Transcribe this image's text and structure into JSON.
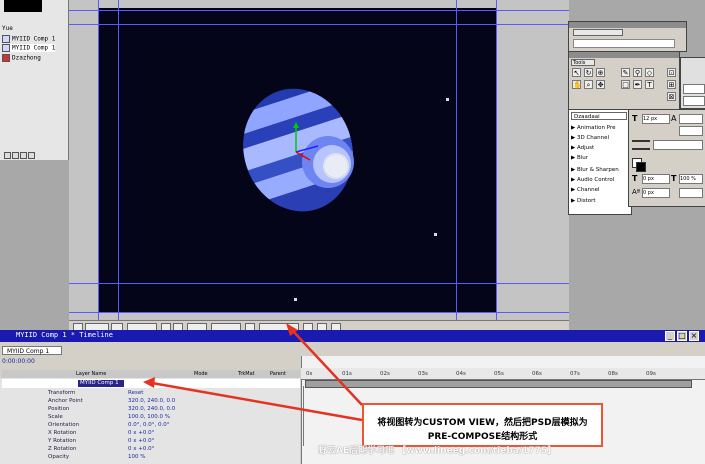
{
  "project": {
    "items": [
      {
        "label": "Yue"
      },
      {
        "label": "MYIID Comp 1"
      },
      {
        "label": "MYIID Comp 1"
      },
      {
        "label": "Dzazhong"
      }
    ]
  },
  "tools": {
    "title": "Tools"
  },
  "effects": {
    "search_value": "Dzaadaai",
    "items": [
      "▶ Animation Pre",
      "▶ 3D Channel",
      "▶ Adjust",
      "▶ Blur",
      "▶ Blur & Sharpen",
      "▶ Audio Control",
      "▶ Channel",
      "▶ Distort"
    ]
  },
  "character": {
    "font_size": "12 px",
    "size_b": "0 px",
    "v_scale": "100 %",
    "h_scale": "0 px"
  },
  "timeline": {
    "title": "MYIID Comp 1 * Timeline",
    "tab": "MYIID Comp 1",
    "time": "0:00:00:00",
    "col_source": "Layer Name",
    "col_mode": "Mode",
    "col_trk": "TrkMat",
    "col_parent": "Parent",
    "layer_name": "MYIID Comp 1",
    "ruler_ticks": [
      "0s",
      "01s",
      "02s",
      "03s",
      "04s",
      "05s",
      "06s",
      "07s",
      "08s",
      "09s"
    ],
    "props": [
      {
        "name": "Transform",
        "value": "Reset"
      },
      {
        "name": "Anchor Point",
        "value": "320.0, 240.0, 0.0"
      },
      {
        "name": "Position",
        "value": "320.0, 240.0, 0.0"
      },
      {
        "name": "Scale",
        "value": "100.0, 100.0 %"
      },
      {
        "name": "Orientation",
        "value": "0.0°, 0.0°, 0.0°"
      },
      {
        "name": "X Rotation",
        "value": "0 x +0.0°"
      },
      {
        "name": "Y Rotation",
        "value": "0 x +0.0°"
      },
      {
        "name": "Z Rotation",
        "value": "0 x +0.0°"
      },
      {
        "name": "Opacity",
        "value": "100 %"
      }
    ]
  },
  "annotation": {
    "line1": "将视图转为CUSTOM VIEW，然后把PSD层模拟为",
    "line2": "PRE-COMPOSE结构形式"
  },
  "watermark": "野云AE后期学习吧 【www.lineeg.com/tieba/1775】",
  "colors": {
    "canvas": "#05051a",
    "sphere_light": "#9db0ff",
    "sphere_dark": "#2234a8",
    "title_bar": "#1a1ab0",
    "arrow": "#e53322"
  }
}
